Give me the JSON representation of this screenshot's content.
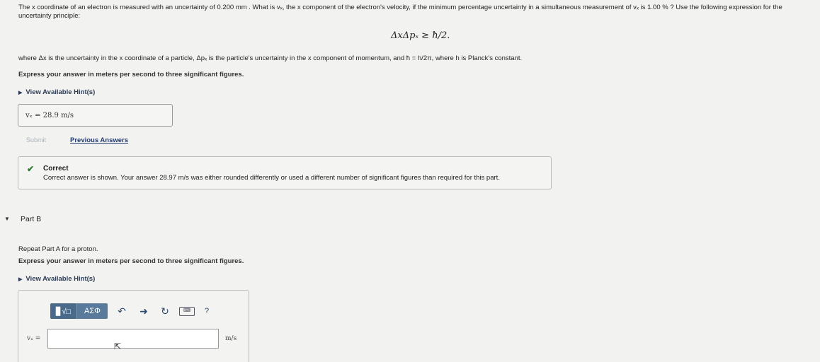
{
  "question": {
    "intro": "The x coordinate of an electron is measured with an uncertainty of 0.200 mm . What is vₓ, the x component of the electron's velocity, if the minimum percentage uncertainty in a simultaneous measurement of vₓ is 1.00 % ? Use the following expression for the uncertainty principle:",
    "formula": "ΔxΔpₓ ≥ ħ/2.",
    "where_text": "where Δx is the uncertainty in the x coordinate of a particle, Δpₓ is the particle's uncertainty in the x component of momentum, and ħ = h/2π, where h is Planck's constant."
  },
  "part_a": {
    "instruction": "Express your answer in meters per second to three significant figures.",
    "hint_label": "View Available Hint(s)",
    "answer_value": "vₓ = 28.9 m/s",
    "submit_label": "Submit",
    "previous_answers_label": "Previous Answers",
    "feedback": {
      "status": "Correct",
      "message": "Correct answer is shown. Your answer 28.97 m/s was either rounded differently or used a different number of significant figures than required for this part."
    }
  },
  "part_b": {
    "title": "Part B",
    "prompt": "Repeat Part A for a proton.",
    "instruction": "Express your answer in meters per second to three significant figures.",
    "hint_label": "View Available Hint(s)",
    "toolbar": {
      "templates_label": "▊√□",
      "greek_label": "ΑΣΦ",
      "help_label": "?"
    },
    "input_label": "vₓ =",
    "input_value": "",
    "unit": "m/s"
  }
}
